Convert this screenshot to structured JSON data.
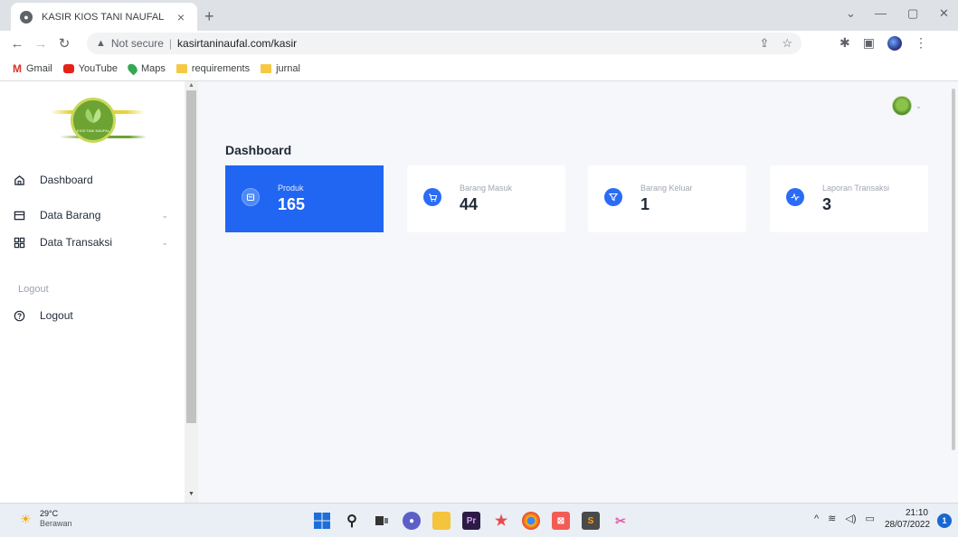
{
  "browser": {
    "tab_title": "KASIR KIOS TANI NAUFAL",
    "tab_close": "×",
    "new_tab": "+",
    "security_label": "Not secure",
    "url": "kasirtaninaufal.com/kasir",
    "bookmarks": [
      {
        "label": "Gmail",
        "icon": "gmail-icon"
      },
      {
        "label": "YouTube",
        "icon": "youtube-icon"
      },
      {
        "label": "Maps",
        "icon": "maps-icon"
      },
      {
        "label": "requirements",
        "icon": "folder-icon"
      },
      {
        "label": "jurnal",
        "icon": "folder-icon"
      }
    ]
  },
  "sidebar": {
    "items": [
      {
        "label": "Dashboard",
        "icon": "home-icon"
      },
      {
        "label": "Data Barang",
        "icon": "box-icon",
        "has_chevron": true
      },
      {
        "label": "Data Transaksi",
        "icon": "grid-icon",
        "has_chevron": true
      }
    ],
    "section_label": "Logout",
    "logout_label": "Logout"
  },
  "main": {
    "page_title": "Dashboard",
    "cards": [
      {
        "label": "Produk",
        "value": "165",
        "icon": "bag-icon",
        "active": true
      },
      {
        "label": "Barang Masuk",
        "value": "44",
        "icon": "cart-icon",
        "active": false
      },
      {
        "label": "Barang Keluar",
        "value": "1",
        "icon": "filter-icon",
        "active": false
      },
      {
        "label": "Laporan Transaksi",
        "value": "3",
        "icon": "activity-icon",
        "active": false
      }
    ]
  },
  "taskbar": {
    "temperature": "29°C",
    "weather": "Berawan",
    "time": "21:10",
    "date": "28/07/2022",
    "notifications": "1"
  },
  "colors": {
    "accent": "#2166f3",
    "page_bg": "#f6f7fb"
  }
}
